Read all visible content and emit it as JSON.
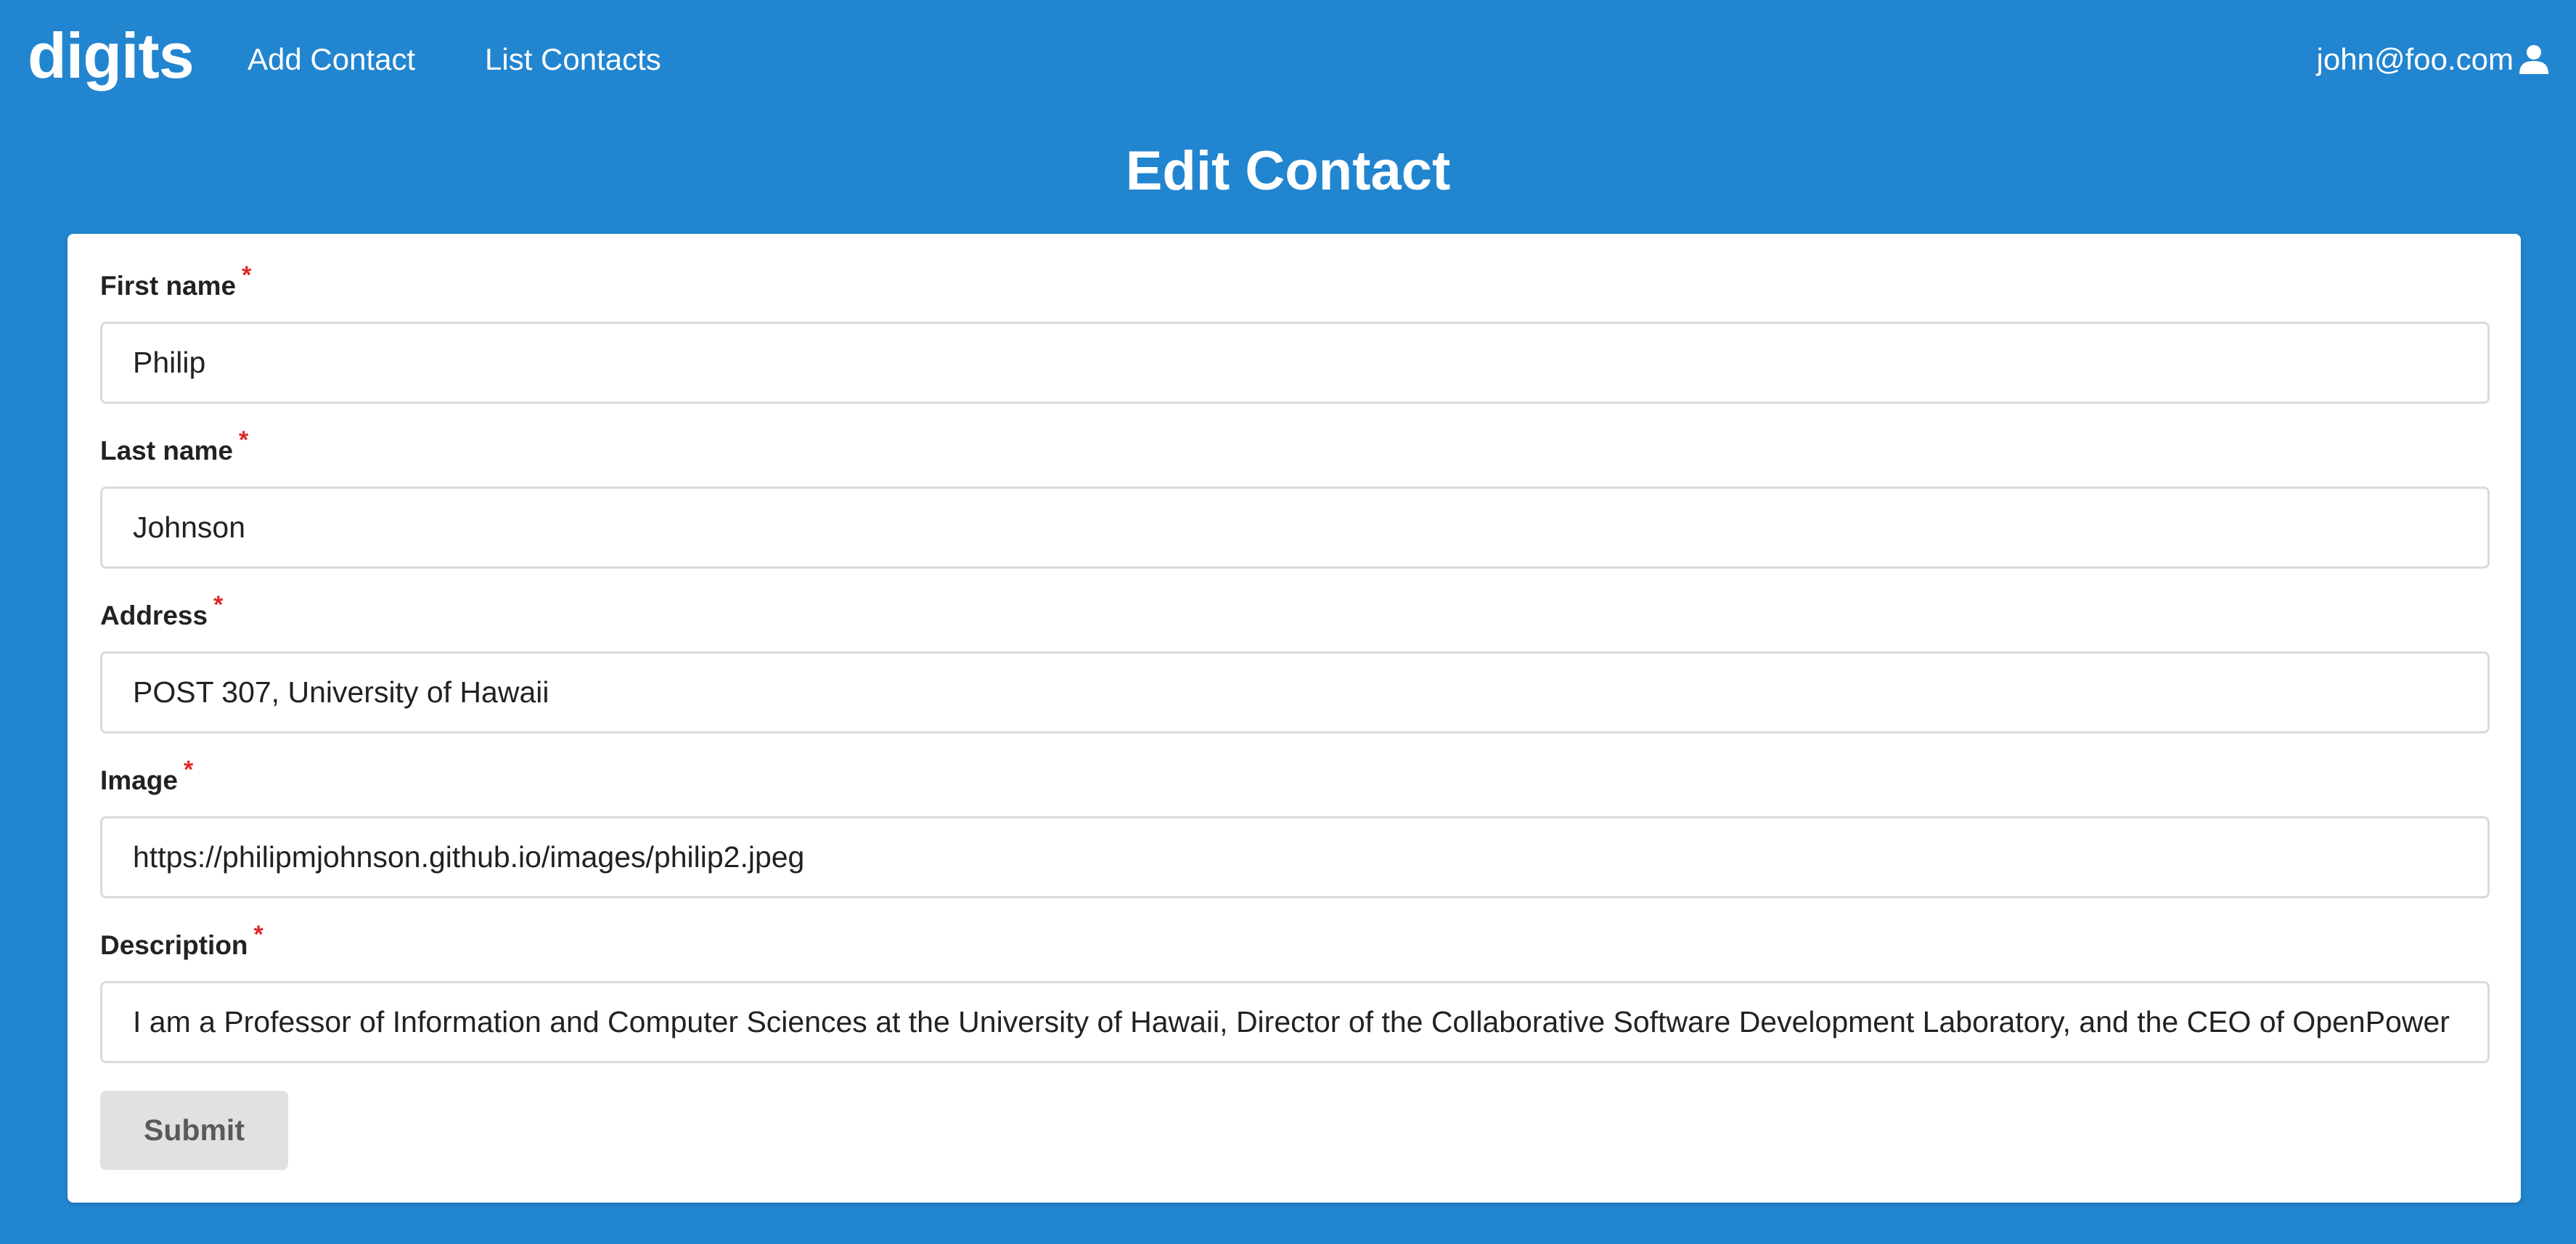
{
  "navbar": {
    "brand": "digits",
    "links": [
      {
        "label": "Add Contact"
      },
      {
        "label": "List Contacts"
      }
    ],
    "user": {
      "email": "john@foo.com",
      "icon": "user-icon"
    }
  },
  "page": {
    "title": "Edit Contact"
  },
  "form": {
    "fields": [
      {
        "label": "First name",
        "required_mark": "*",
        "value": "Philip"
      },
      {
        "label": "Last name",
        "required_mark": "*",
        "value": "Johnson"
      },
      {
        "label": "Address",
        "required_mark": "*",
        "value": "POST 307, University of Hawaii"
      },
      {
        "label": "Image",
        "required_mark": "*",
        "value": "https://philipmjohnson.github.io/images/philip2.jpeg"
      },
      {
        "label": "Description",
        "required_mark": "*",
        "value": "I am a Professor of Information and Computer Sciences at the University of Hawaii, Director of the Collaborative Software Development Laboratory, and the CEO of OpenPower"
      }
    ],
    "submit_label": "Submit"
  },
  "colors": {
    "background": "#2185d0",
    "required": "#db2828",
    "button": "#e0e1e2"
  }
}
